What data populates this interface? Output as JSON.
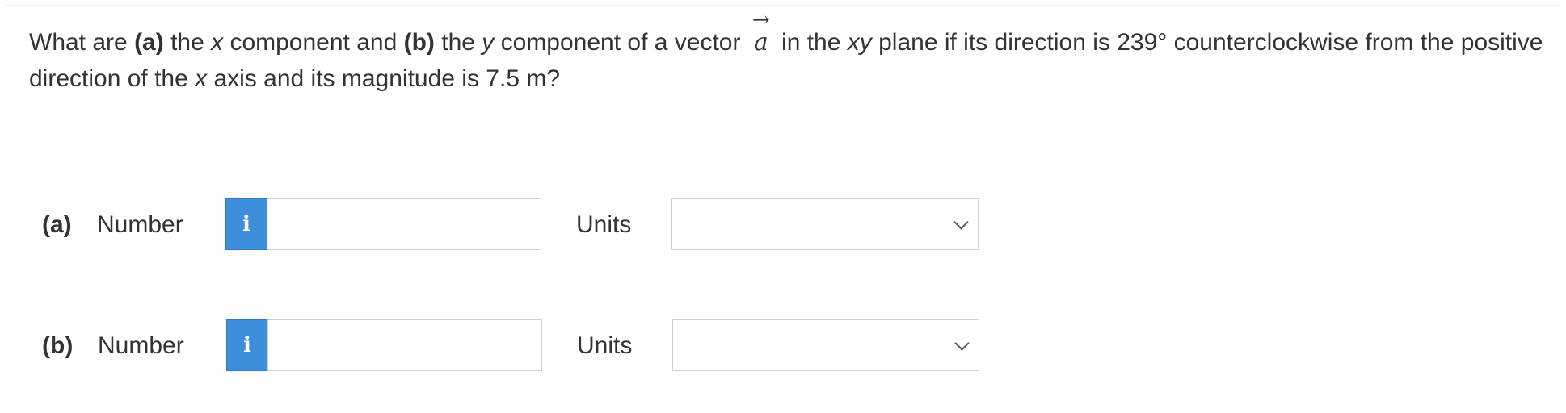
{
  "question": {
    "p1": "What are ",
    "a_tag": "(a)",
    "p2": " the ",
    "x_var": "x",
    "p3": " component and ",
    "b_tag": "(b)",
    "p4": " the ",
    "y_var": "y",
    "p5": " component of a vector ",
    "vector_symbol": "a",
    "vector_arrow": "→",
    "p6": " in the ",
    "xy_var": "xy",
    "p7": " plane if its direction is 239° counterclockwise from the positive direction of the ",
    "x_var2": "x",
    "p8": " axis and its magnitude is 7.5 m?"
  },
  "parts": [
    {
      "tag": "(a)",
      "number_label": "Number",
      "info_icon": "i",
      "number_value": "",
      "units_label": "Units",
      "units_selected": ""
    },
    {
      "tag": "(b)",
      "number_label": "Number",
      "info_icon": "i",
      "number_value": "",
      "units_label": "Units",
      "units_selected": ""
    }
  ],
  "icons": {
    "info": "info-icon",
    "dropdown": "chevron-down-icon"
  },
  "colors": {
    "info_button": "#3d8fdc",
    "text": "#333333",
    "border": "#cfcfcf"
  }
}
